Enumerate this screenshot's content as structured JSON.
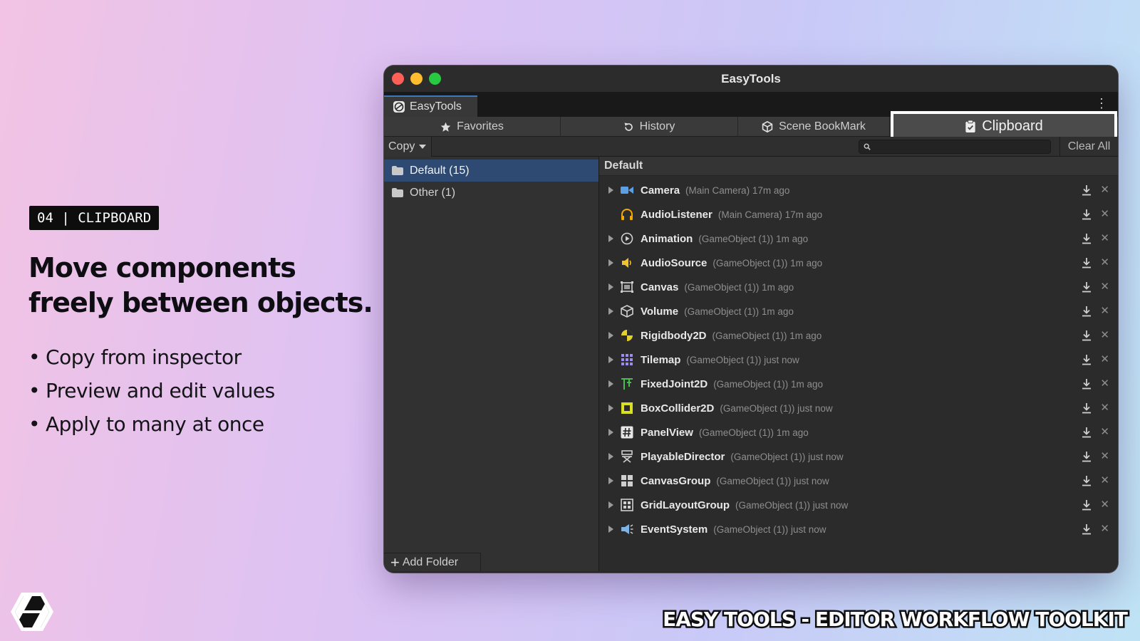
{
  "promo": {
    "badge": "04 | CLIPBOARD",
    "headline": [
      "Move components",
      "freely between objects."
    ],
    "bullets": [
      "Copy from inspector",
      "Preview and edit values",
      "Apply to many at once"
    ],
    "bullet_char": "•",
    "footer_title": "EASY TOOLS - EDITOR WORKFLOW TOOLKIT"
  },
  "window": {
    "title": "EasyTools",
    "doc_tab": "EasyTools",
    "menu_glyph": "⋮",
    "tabs": [
      {
        "label": "Favorites",
        "icon": "star-icon"
      },
      {
        "label": "History",
        "icon": "history-icon"
      },
      {
        "label": "Scene BookMark",
        "icon": "cube-icon"
      },
      {
        "label": "Clipboard",
        "icon": "clipboard-icon",
        "active": true
      }
    ],
    "toolbar": {
      "copy_label": "Copy",
      "search_placeholder": "",
      "clear_all": "Clear All"
    },
    "folders": [
      {
        "label": "Default (15)",
        "selected": true
      },
      {
        "label": "Other (1)",
        "selected": false
      }
    ],
    "add_folder": "Add Folder",
    "section_title": "Default",
    "rows": [
      {
        "name": "Camera",
        "meta": "(Main Camera) 17m ago",
        "icon": "camera-icon",
        "expandable": true
      },
      {
        "name": "AudioListener",
        "meta": "(Main Camera) 17m ago",
        "icon": "headphones-icon",
        "expandable": false
      },
      {
        "name": "Animation",
        "meta": "(GameObject (1)) 1m ago",
        "icon": "play-circle-icon",
        "expandable": true
      },
      {
        "name": "AudioSource",
        "meta": "(GameObject (1)) 1m ago",
        "icon": "speaker-icon",
        "expandable": true
      },
      {
        "name": "Canvas",
        "meta": "(GameObject (1)) 1m ago",
        "icon": "canvas-icon",
        "expandable": true
      },
      {
        "name": "Volume",
        "meta": "(GameObject (1)) 1m ago",
        "icon": "volume-cube-icon",
        "expandable": true
      },
      {
        "name": "Rigidbody2D",
        "meta": "(GameObject (1)) 1m ago",
        "icon": "rigidbody-icon",
        "expandable": true
      },
      {
        "name": "Tilemap",
        "meta": "(GameObject (1)) just now",
        "icon": "tilemap-icon",
        "expandable": true
      },
      {
        "name": "FixedJoint2D",
        "meta": "(GameObject (1)) 1m ago",
        "icon": "joint-icon",
        "expandable": true
      },
      {
        "name": "BoxCollider2D",
        "meta": "(GameObject (1)) just now",
        "icon": "box-collider-icon",
        "expandable": true
      },
      {
        "name": "PanelView",
        "meta": "(GameObject (1)) 1m ago",
        "icon": "hash-icon",
        "expandable": true
      },
      {
        "name": "PlayableDirector",
        "meta": "(GameObject (1)) just now",
        "icon": "director-chair-icon",
        "expandable": true
      },
      {
        "name": "CanvasGroup",
        "meta": "(GameObject (1)) just now",
        "icon": "canvas-group-icon",
        "expandable": true
      },
      {
        "name": "GridLayoutGroup",
        "meta": "(GameObject (1)) just now",
        "icon": "grid-layout-icon",
        "expandable": true
      },
      {
        "name": "EventSystem",
        "meta": "(GameObject (1)) just now",
        "icon": "event-system-icon",
        "expandable": true
      }
    ],
    "row_close_glyph": "✕"
  },
  "colors": {
    "accent_selected": "#2e4a73",
    "window_bg": "#282828"
  }
}
